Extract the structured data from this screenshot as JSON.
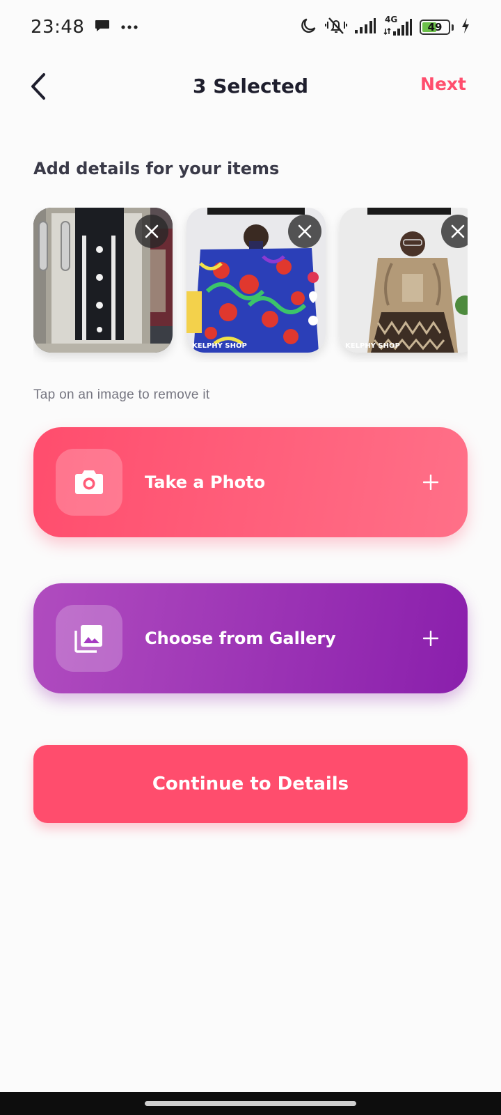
{
  "status_bar": {
    "time": "23:48",
    "notification_icons": [
      "chat-bubble-icon",
      "more-dots-icon"
    ],
    "system_icons": [
      "moon-icon",
      "vibrate-silent-icon",
      "signal-icon",
      "signal-4g-icon",
      "battery-icon",
      "charging-icon"
    ],
    "network_label": "4G",
    "battery_level": "49"
  },
  "header": {
    "back_icon": "chevron-left-icon",
    "title": "3 Selected",
    "next_label": "Next"
  },
  "section": {
    "title": "Add details for your items",
    "hint": "Tap on an image to remove it"
  },
  "thumbnails": [
    {
      "description": "black embroidered outfit in glass door display",
      "label": ""
    },
    {
      "description": "colorful printed shirt held by person",
      "label": "KELPHY SHOP"
    },
    {
      "description": "tan patterned outfit worn by person",
      "label": "KELPHY SHOP"
    }
  ],
  "actions": {
    "take_photo": {
      "label": "Take a Photo",
      "icon": "camera-icon",
      "trailing_icon": "plus-icon"
    },
    "gallery": {
      "label": "Choose from Gallery",
      "icon": "photo-library-icon",
      "trailing_icon": "plus-icon"
    }
  },
  "continue": {
    "label": "Continue to Details"
  },
  "colors": {
    "accent": "#ff4d6d",
    "gallery_start": "#b04cbf",
    "gallery_end": "#8a1fac",
    "title": "#1e1e2d",
    "background": "#fbfbfb"
  }
}
